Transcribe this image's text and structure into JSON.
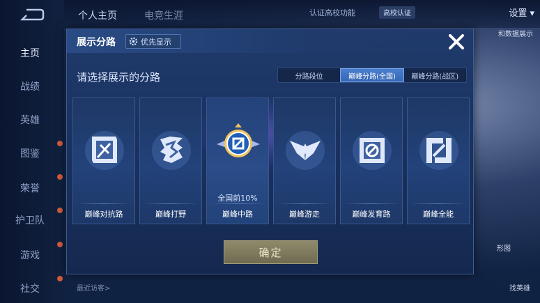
{
  "background": {
    "left_nav": {
      "items": [
        "主页",
        "战绩",
        "英雄",
        "图鉴",
        "荣誉",
        "护卫队",
        "游戏",
        "社交"
      ],
      "active_index": 0
    },
    "top_tabs": [
      "个人主页",
      "电竞生涯"
    ],
    "top_right": {
      "verify_text": "认证高校功能",
      "badge_label": "高校认证",
      "settings_label": "设置"
    },
    "bottom_text": "最近访客>",
    "right_side": {
      "ribbon_text": "和数据展示",
      "label_1": "形图",
      "label_2": "找英雄"
    }
  },
  "modal": {
    "title": "展示分路",
    "priority_label": "优先显示",
    "subtitle": "请选择展示的分路",
    "segments": [
      {
        "label": "分路段位",
        "active": false
      },
      {
        "label": "巅峰分路(全国)",
        "active": true
      },
      {
        "label": "巅峰分路(战区)",
        "active": false
      }
    ],
    "cards": [
      {
        "name": "巅峰对抗路",
        "emblem": "sword-emblem-icon",
        "rank": "",
        "selected": false
      },
      {
        "name": "巅峰打野",
        "emblem": "dragon-emblem-icon",
        "rank": "",
        "selected": false
      },
      {
        "name": "巅峰中路",
        "emblem": "mage-emblem-icon",
        "rank": "全国前10%",
        "selected": true
      },
      {
        "name": "巅峰游走",
        "emblem": "wings-emblem-icon",
        "rank": "",
        "selected": false
      },
      {
        "name": "巅峰发育路",
        "emblem": "target-emblem-icon",
        "rank": "",
        "selected": false
      },
      {
        "name": "巅峰全能",
        "emblem": "allround-emblem-icon",
        "rank": "",
        "selected": false
      }
    ],
    "confirm_label": "确定"
  },
  "colors": {
    "accent_blue": "#3566b2",
    "gold": "#f0c35a",
    "confirm_button": "#7c7759"
  }
}
